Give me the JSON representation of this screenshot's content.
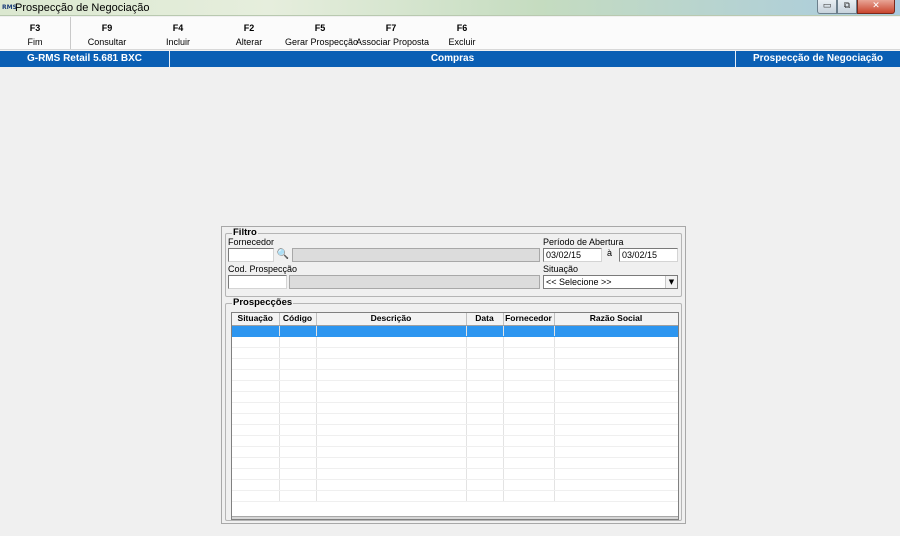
{
  "window": {
    "app_icon_text": "RMS",
    "title": "Prospecção de Negociação",
    "controls": {
      "minimize": "▭",
      "restore": "⧉",
      "close": "✕"
    }
  },
  "toolbar": {
    "buttons": [
      {
        "key": "F3",
        "label": "Fim"
      },
      {
        "key": "F9",
        "label": "Consultar"
      },
      {
        "key": "F4",
        "label": "Incluir"
      },
      {
        "key": "F2",
        "label": "Alterar"
      },
      {
        "key": "F5",
        "label": "Gerar Prospecção"
      },
      {
        "key": "F7",
        "label": "Associar Proposta"
      },
      {
        "key": "F6",
        "label": "Excluir"
      }
    ]
  },
  "statusbar": {
    "version": "G-RMS Retail 5.681 BXC",
    "module": "Compras",
    "screen": "Prospecção de Negociação",
    "color": "#0a5fb4"
  },
  "filtro": {
    "legend": "Filtro",
    "fornecedor_label": "Fornecedor",
    "fornecedor_value": "",
    "fornecedor_desc": "",
    "search_icon": "binoculars-icon",
    "cod_label": "Cod. Prospecção",
    "cod_value": "",
    "cod_desc": "",
    "periodo_label": "Período de Abertura",
    "periodo_de": "03/02/15",
    "periodo_sep": "à",
    "periodo_ate": "03/02/15",
    "situacao_label": "Situação",
    "situacao_selected": "<< Selecione >>"
  },
  "prospeccoes": {
    "legend": "Prospecções",
    "columns": [
      "Situação",
      "Código",
      "Descrição",
      "Data",
      "Fornecedor",
      "Razão Social"
    ],
    "selected_row_color": "#2d96f0"
  }
}
